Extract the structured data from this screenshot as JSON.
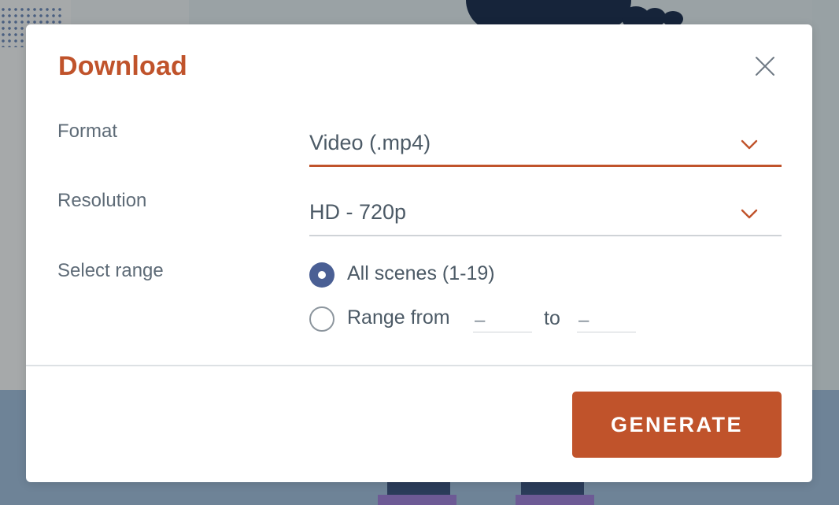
{
  "dialog": {
    "title": "Download",
    "close_icon": "close-icon"
  },
  "format": {
    "label": "Format",
    "value": "Video (.mp4)",
    "icon": "chevron-down-icon"
  },
  "resolution": {
    "label": "Resolution",
    "value": "HD - 720p",
    "icon": "chevron-down-icon"
  },
  "range": {
    "label": "Select range",
    "options": [
      {
        "label": "All scenes (1-19)",
        "checked": true
      },
      {
        "label": "Range from",
        "checked": false
      }
    ],
    "from_value": "–",
    "to_label": "to",
    "to_value": "–"
  },
  "footer": {
    "generate_label": "GENERATE"
  },
  "colors": {
    "accent": "#c0532b",
    "radio_checked": "#4a5f94",
    "text": "#4c5a66",
    "label": "#5e6b77"
  }
}
